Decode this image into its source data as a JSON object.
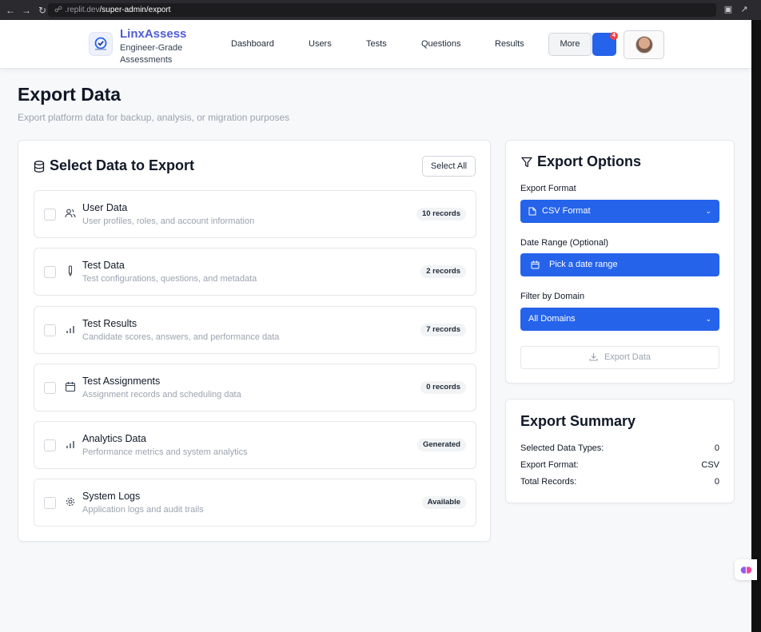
{
  "browser": {
    "url_domain": ".replit.dev",
    "url_path": "/super-admin/export"
  },
  "header": {
    "brand": "LinxAssess",
    "tagline": "Engineer-Grade Assessments",
    "nav": [
      "Dashboard",
      "Users",
      "Tests",
      "Questions",
      "Results"
    ],
    "more_label": "More",
    "notification_count": "4"
  },
  "page": {
    "title": "Export Data",
    "subtitle": "Export platform data for backup, analysis, or migration purposes"
  },
  "select_panel": {
    "title": "Select Data to Export",
    "select_all_label": "Select All",
    "items": [
      {
        "name": "User Data",
        "desc": "User profiles, roles, and account information",
        "badge": "10 records",
        "icon": "users-icon",
        "checked": false
      },
      {
        "name": "Test Data",
        "desc": "Test configurations, questions, and metadata",
        "badge": "2 records",
        "icon": "pencil-icon",
        "checked": false
      },
      {
        "name": "Test Results",
        "desc": "Candidate scores, answers, and performance data",
        "badge": "7 records",
        "icon": "bar-chart-icon",
        "checked": false
      },
      {
        "name": "Test Assignments",
        "desc": "Assignment records and scheduling data",
        "badge": "0 records",
        "icon": "calendar-icon",
        "checked": false
      },
      {
        "name": "Analytics Data",
        "desc": "Performance metrics and system analytics",
        "badge": "Generated",
        "icon": "bar-chart-icon",
        "checked": false
      },
      {
        "name": "System Logs",
        "desc": "Application logs and audit trails",
        "badge": "Available",
        "icon": "gear-icon",
        "checked": false
      }
    ]
  },
  "options_panel": {
    "title": "Export Options",
    "format_label": "Export Format",
    "format_value": "CSV Format",
    "date_label": "Date Range (Optional)",
    "date_placeholder": "Pick a date range",
    "domain_label": "Filter by Domain",
    "domain_value": "All Domains",
    "export_button": "Export Data"
  },
  "summary_panel": {
    "title": "Export Summary",
    "rows": [
      {
        "label": "Selected Data Types:",
        "value": "0"
      },
      {
        "label": "Export Format:",
        "value": "CSV"
      },
      {
        "label": "Total Records:",
        "value": "0"
      }
    ]
  },
  "colors": {
    "primary": "#2563eb",
    "brand": "#4f5bd5",
    "badge_red": "#ef4444"
  }
}
